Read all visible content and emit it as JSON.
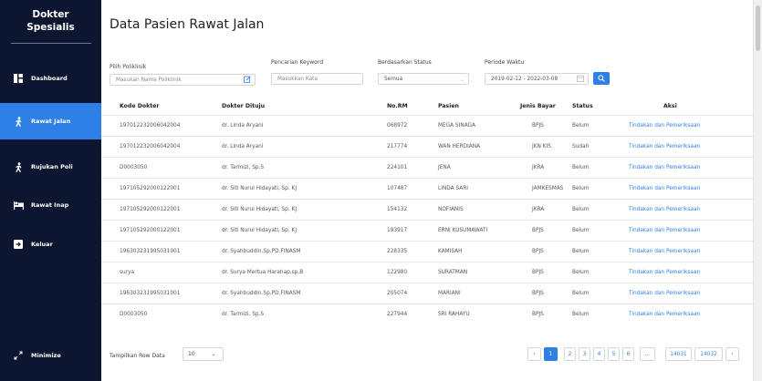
{
  "sidebar": {
    "brand_line1": "Dokter",
    "brand_line2": "Spesialis",
    "items": [
      {
        "label": "Dashboard",
        "icon": "dashboard-icon"
      },
      {
        "label": "Rawat Jalan",
        "icon": "walking-icon"
      },
      {
        "label": "Rujukan Poli",
        "icon": "walking-icon"
      },
      {
        "label": "Rawat Inap",
        "icon": "bed-icon"
      },
      {
        "label": "Keluar",
        "icon": "logout-icon"
      }
    ],
    "minimize_label": "Minimize"
  },
  "page_title": "Data Pasien Rawat Jalan",
  "filters": {
    "poli_label": "Pilih Poliklinik",
    "poli_placeholder": "Masukan Nama Poliklinik",
    "keyword_label": "Pencarian Keyword",
    "keyword_placeholder": "Masukkan Kata",
    "status_label": "Berdasarkan Status",
    "status_value": "Semua",
    "periode_label": "Periode Waktu",
    "periode_value": "2019-02-12 - 2022-03-08"
  },
  "table": {
    "headers": [
      "Kode Dokter",
      "Dokter Dituju",
      "No.RM",
      "Pasien",
      "Jenis Bayar",
      "Status",
      "Aksi"
    ],
    "rows": [
      [
        "197012232006042004",
        "dr. Linda Aryani",
        "068972",
        "MEGA SINAGA",
        "BPJS",
        "Belum",
        "Tindakan dan Pemeriksaan"
      ],
      [
        "197012232006042004",
        "dr. Linda Aryani",
        "217774",
        "WAN HERDIANA",
        "JKN KIS",
        "Sudah",
        "Tindakan dan Pemeriksaan"
      ],
      [
        "D0003050",
        "dr. Tarmizi, Sp.S",
        "224101",
        "JENA",
        "JKRA",
        "Belum",
        "Tindakan dan Pemeriksaan"
      ],
      [
        "197105292000122001",
        "dr. Siti Nurul Hidayati, Sp. KJ",
        "107487",
        "LINDA SARI",
        "JAMKESMAS",
        "Belum",
        "Tindakan dan Pemeriksaan"
      ],
      [
        "197105292000122001",
        "dr. Siti Nurul Hidayati, Sp. KJ",
        "154132",
        "NOFIANIS",
        "JKRA",
        "Belum",
        "Tindakan dan Pemeriksaan"
      ],
      [
        "197105292000122001",
        "dr. Siti Nurul Hidayati, Sp. KJ",
        "193917",
        "ERNI KUSUMAWATI",
        "BPJS",
        "Belum",
        "Tindakan dan Pemeriksaan"
      ],
      [
        "196303231995031001",
        "dr. Syahbuddin.Sp.PD.FINASM",
        "228335",
        "KAMISAH",
        "BPJS",
        "Belum",
        "Tindakan dan Pemeriksaan"
      ],
      [
        "surya",
        "dr. Surya Mertua Harahap,sp.B",
        "122980",
        "SURATMAN",
        "BPJS",
        "Belum",
        "Tindakan dan Pemeriksaan"
      ],
      [
        "196303231995031001",
        "dr. Syahbuddin.Sp.PD.FINASM",
        "205074",
        "MARIANI",
        "BPJS",
        "Belum",
        "Tindakan dan Pemeriksaan"
      ],
      [
        "D0003050",
        "dr. Tarmizi, Sp.S",
        "227944",
        "SRI RAHAYU",
        "BPJS",
        "Belum",
        "Tindakan dan Pemeriksaan"
      ]
    ]
  },
  "footer": {
    "rows_label": "Tampilkan Row Data",
    "rows_value": "10",
    "pages": [
      "‹",
      "1",
      "2",
      "3",
      "4",
      "5",
      "6",
      "...",
      "14031",
      "14032",
      "›"
    ]
  },
  "colors": {
    "sidebar_bg": "#0c1631",
    "accent": "#2f80e6"
  }
}
